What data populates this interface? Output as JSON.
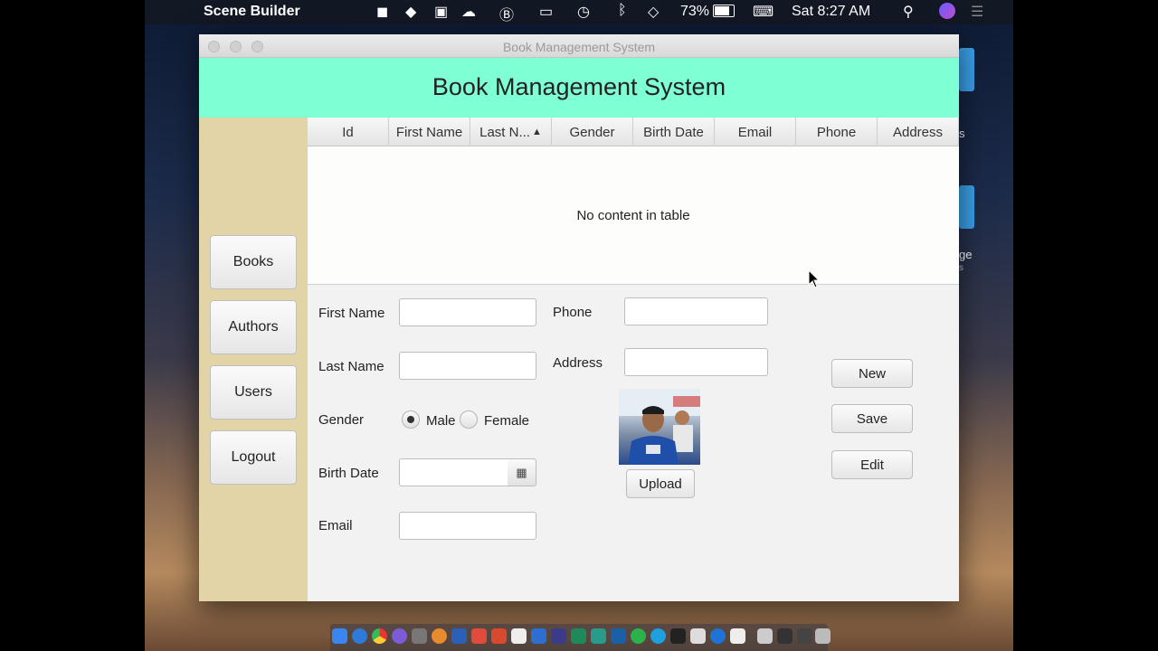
{
  "menubar": {
    "app_name": "Scene Builder",
    "battery": "73%",
    "clock": "Sat 8:27 AM"
  },
  "desktop": {
    "fragment_1": "s",
    "fragment_2": "ge",
    "fragment_3": "s"
  },
  "window": {
    "title": "Book Management System",
    "header_title": "Book Management System"
  },
  "sidebar": {
    "items": [
      {
        "label": "Books"
      },
      {
        "label": "Authors"
      },
      {
        "label": "Users"
      },
      {
        "label": "Logout"
      }
    ]
  },
  "table": {
    "columns": [
      "Id",
      "First Name",
      "Last N...",
      "Gender",
      "Birth Date",
      "Email",
      "Phone",
      "Address"
    ],
    "sorted_column_index": 2,
    "empty_message": "No content in table"
  },
  "form": {
    "first_name_label": "First Name",
    "last_name_label": "Last Name",
    "gender_label": "Gender",
    "gender_options": [
      "Male",
      "Female"
    ],
    "gender_selected": "Male",
    "birth_date_label": "Birth Date",
    "email_label": "Email",
    "phone_label": "Phone",
    "address_label": "Address",
    "upload_label": "Upload"
  },
  "actions": {
    "new_label": "New",
    "save_label": "Save",
    "edit_label": "Edit"
  },
  "colors": {
    "header_bg": "#7fffd4",
    "sidebar_bg": "#e2d4a6"
  }
}
